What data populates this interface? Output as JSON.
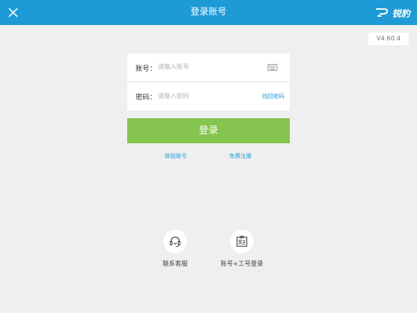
{
  "header": {
    "title": "登录账号",
    "brand": "锐豹"
  },
  "version": "V4.60.4",
  "form": {
    "account_label": "账号：",
    "account_placeholder": "请输入账号",
    "password_label": "密码：",
    "password_placeholder": "请输入密码",
    "forgot_password": "找回密码"
  },
  "login_button": "登录",
  "links": {
    "trial_account": "体验账号",
    "free_register": "免费注册"
  },
  "bottom": {
    "contact_service": "联系客服",
    "account_employee_login": "账号+工号登录"
  },
  "colors": {
    "header_bg": "#1e9bd7",
    "accent_link": "#1e9bd7",
    "login_button_bg": "#85c44e",
    "page_bg": "#efefef"
  }
}
